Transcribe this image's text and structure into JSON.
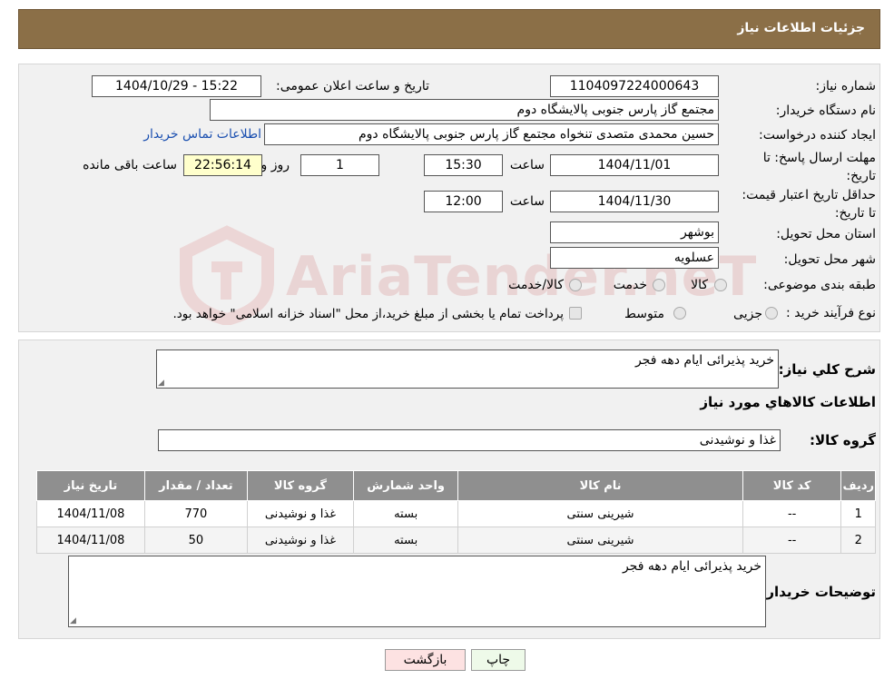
{
  "header": {
    "title": "جزئیات اطلاعات نیاز"
  },
  "watermark": {
    "text": "AriaTender.neT"
  },
  "form": {
    "need_number_label": "شماره نیاز:",
    "need_number": "1104097224000643",
    "announce_label": "تاریخ و ساعت اعلان عمومی:",
    "announce_value": "1404/10/29 - 15:22",
    "buyer_org_label": "نام دستگاه خریدار:",
    "buyer_org": "مجتمع گاز پارس جنوبی  پالایشگاه دوم",
    "creator_label": "ایجاد کننده درخواست:",
    "creator": "حسین محمدی متصدی تنخواه مجتمع گاز پارس جنوبی  پالایشگاه دوم",
    "contact_link": "اطلاعات تماس خریدار",
    "deadline_label": "مهلت ارسال پاسخ: تا تاریخ:",
    "deadline_date": "1404/11/01",
    "time_label": "ساعت",
    "deadline_time": "15:30",
    "days_value": "1",
    "days_label": "روز و",
    "remaining_value": "22:56:14",
    "remaining_label": "ساعت باقی مانده",
    "validity_label": "حداقل تاریخ اعتبار قیمت: تا تاریخ:",
    "validity_date": "1404/11/30",
    "validity_time": "12:00",
    "province_label": "استان محل تحویل:",
    "province": "بوشهر",
    "city_label": "شهر محل تحویل:",
    "city": "عسلویه",
    "category_label": "طبقه بندی موضوعی:",
    "category_options": [
      "کالا",
      "خدمت",
      "کالا/خدمت"
    ],
    "process_label": "نوع فرآیند خرید :",
    "process_options": [
      "جزیی",
      "متوسط"
    ],
    "process_note": "پرداخت تمام یا بخشی از مبلغ خرید،از محل \"اسناد خزانه اسلامی\" خواهد بود."
  },
  "details": {
    "summary_label": "شرح کلي نياز:",
    "summary": "خرید پذیرائی ایام دهه فجر",
    "goods_info_title": "اطلاعات کالاهاي مورد نياز",
    "goods_group_label": "گروه کالا:",
    "goods_group": "غذا و نوشیدنی"
  },
  "table": {
    "headers": [
      "رديف",
      "کد کالا",
      "نام کالا",
      "واحد شمارش",
      "گروه کالا",
      "تعداد / مقدار",
      "تاریخ نیاز"
    ],
    "rows": [
      [
        "1",
        "--",
        "شیرینی سنتی",
        "بسته",
        "غذا و نوشیدنی",
        "770",
        "1404/11/08"
      ],
      [
        "2",
        "--",
        "شیرینی سنتی",
        "بسته",
        "غذا و نوشیدنی",
        "50",
        "1404/11/08"
      ]
    ]
  },
  "buyer_notes": {
    "label": "توضیحات خریدار:",
    "text": "خرید پذیرائی ایام دهه فجر"
  },
  "buttons": {
    "print": "چاپ",
    "back": "بازگشت"
  }
}
